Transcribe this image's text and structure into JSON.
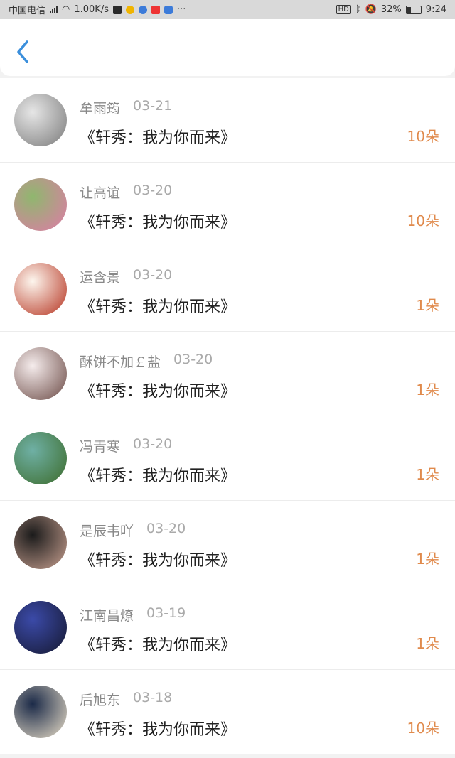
{
  "status_bar": {
    "carrier": "中国电信",
    "speed": "1.00K/s",
    "more": "···",
    "hd": "HD",
    "battery_pct": "32%",
    "time": "9:24"
  },
  "list": [
    {
      "name": "牟雨筠",
      "date": "03-21",
      "title": "《轩秀：我为你而来》",
      "count": "10朵",
      "avatar_colors": [
        "#e6e6e6",
        "#7a7a7a"
      ]
    },
    {
      "name": "让高谊",
      "date": "03-20",
      "title": "《轩秀：我为你而来》",
      "count": "10朵",
      "avatar_colors": [
        "#8fb76e",
        "#e07aa8"
      ]
    },
    {
      "name": "运含景",
      "date": "03-20",
      "title": "《轩秀：我为你而来》",
      "count": "1朵",
      "avatar_colors": [
        "#fdf6ee",
        "#b5321f"
      ]
    },
    {
      "name": "酥饼不加￡盐",
      "date": "03-20",
      "title": "《轩秀：我为你而来》",
      "count": "1朵",
      "avatar_colors": [
        "#f5ecec",
        "#6b4a45"
      ]
    },
    {
      "name": "冯青寒",
      "date": "03-20",
      "title": "《轩秀：我为你而来》",
      "count": "1朵",
      "avatar_colors": [
        "#6fb0a5",
        "#3c6b2a"
      ]
    },
    {
      "name": "是辰韦吖",
      "date": "03-20",
      "title": "《轩秀：我为你而来》",
      "count": "1朵",
      "avatar_colors": [
        "#1b1b1b",
        "#c8a090"
      ]
    },
    {
      "name": "江南昌燎",
      "date": "03-19",
      "title": "《轩秀：我为你而来》",
      "count": "1朵",
      "avatar_colors": [
        "#3b4aa8",
        "#151830"
      ]
    },
    {
      "name": "后旭东",
      "date": "03-18",
      "title": "《轩秀：我为你而来》",
      "count": "10朵",
      "avatar_colors": [
        "#1b2a48",
        "#eadfc9"
      ]
    }
  ]
}
